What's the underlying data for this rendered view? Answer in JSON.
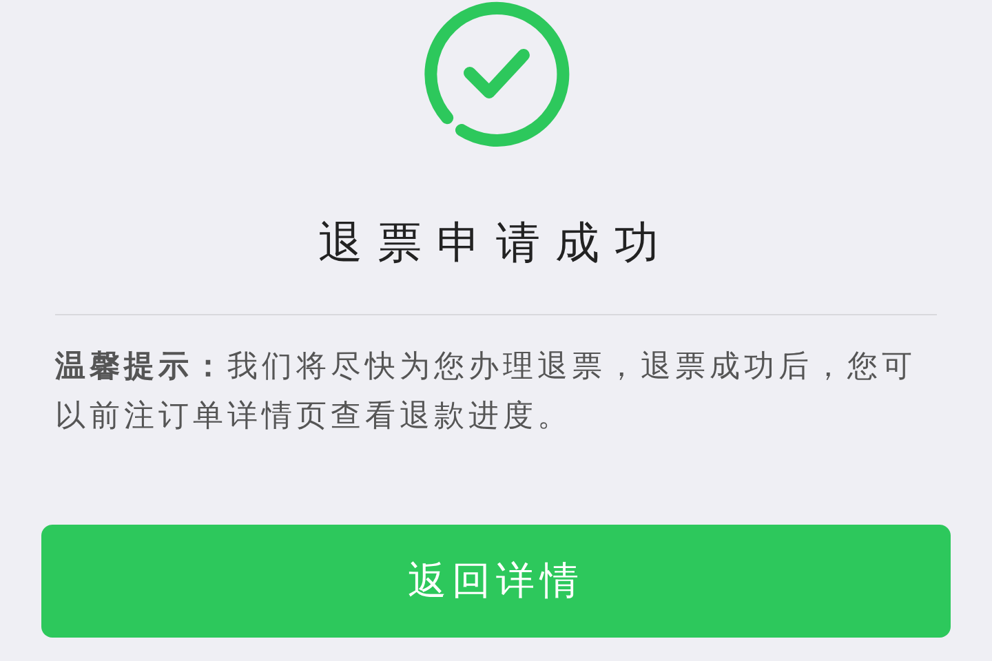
{
  "title": "退票申请成功",
  "hint": "**温馨提示：**我们将尽快为您办理退票，退票成功后，您可以前注订单详情页查看退款进度。",
  "button": "返回详情"
}
